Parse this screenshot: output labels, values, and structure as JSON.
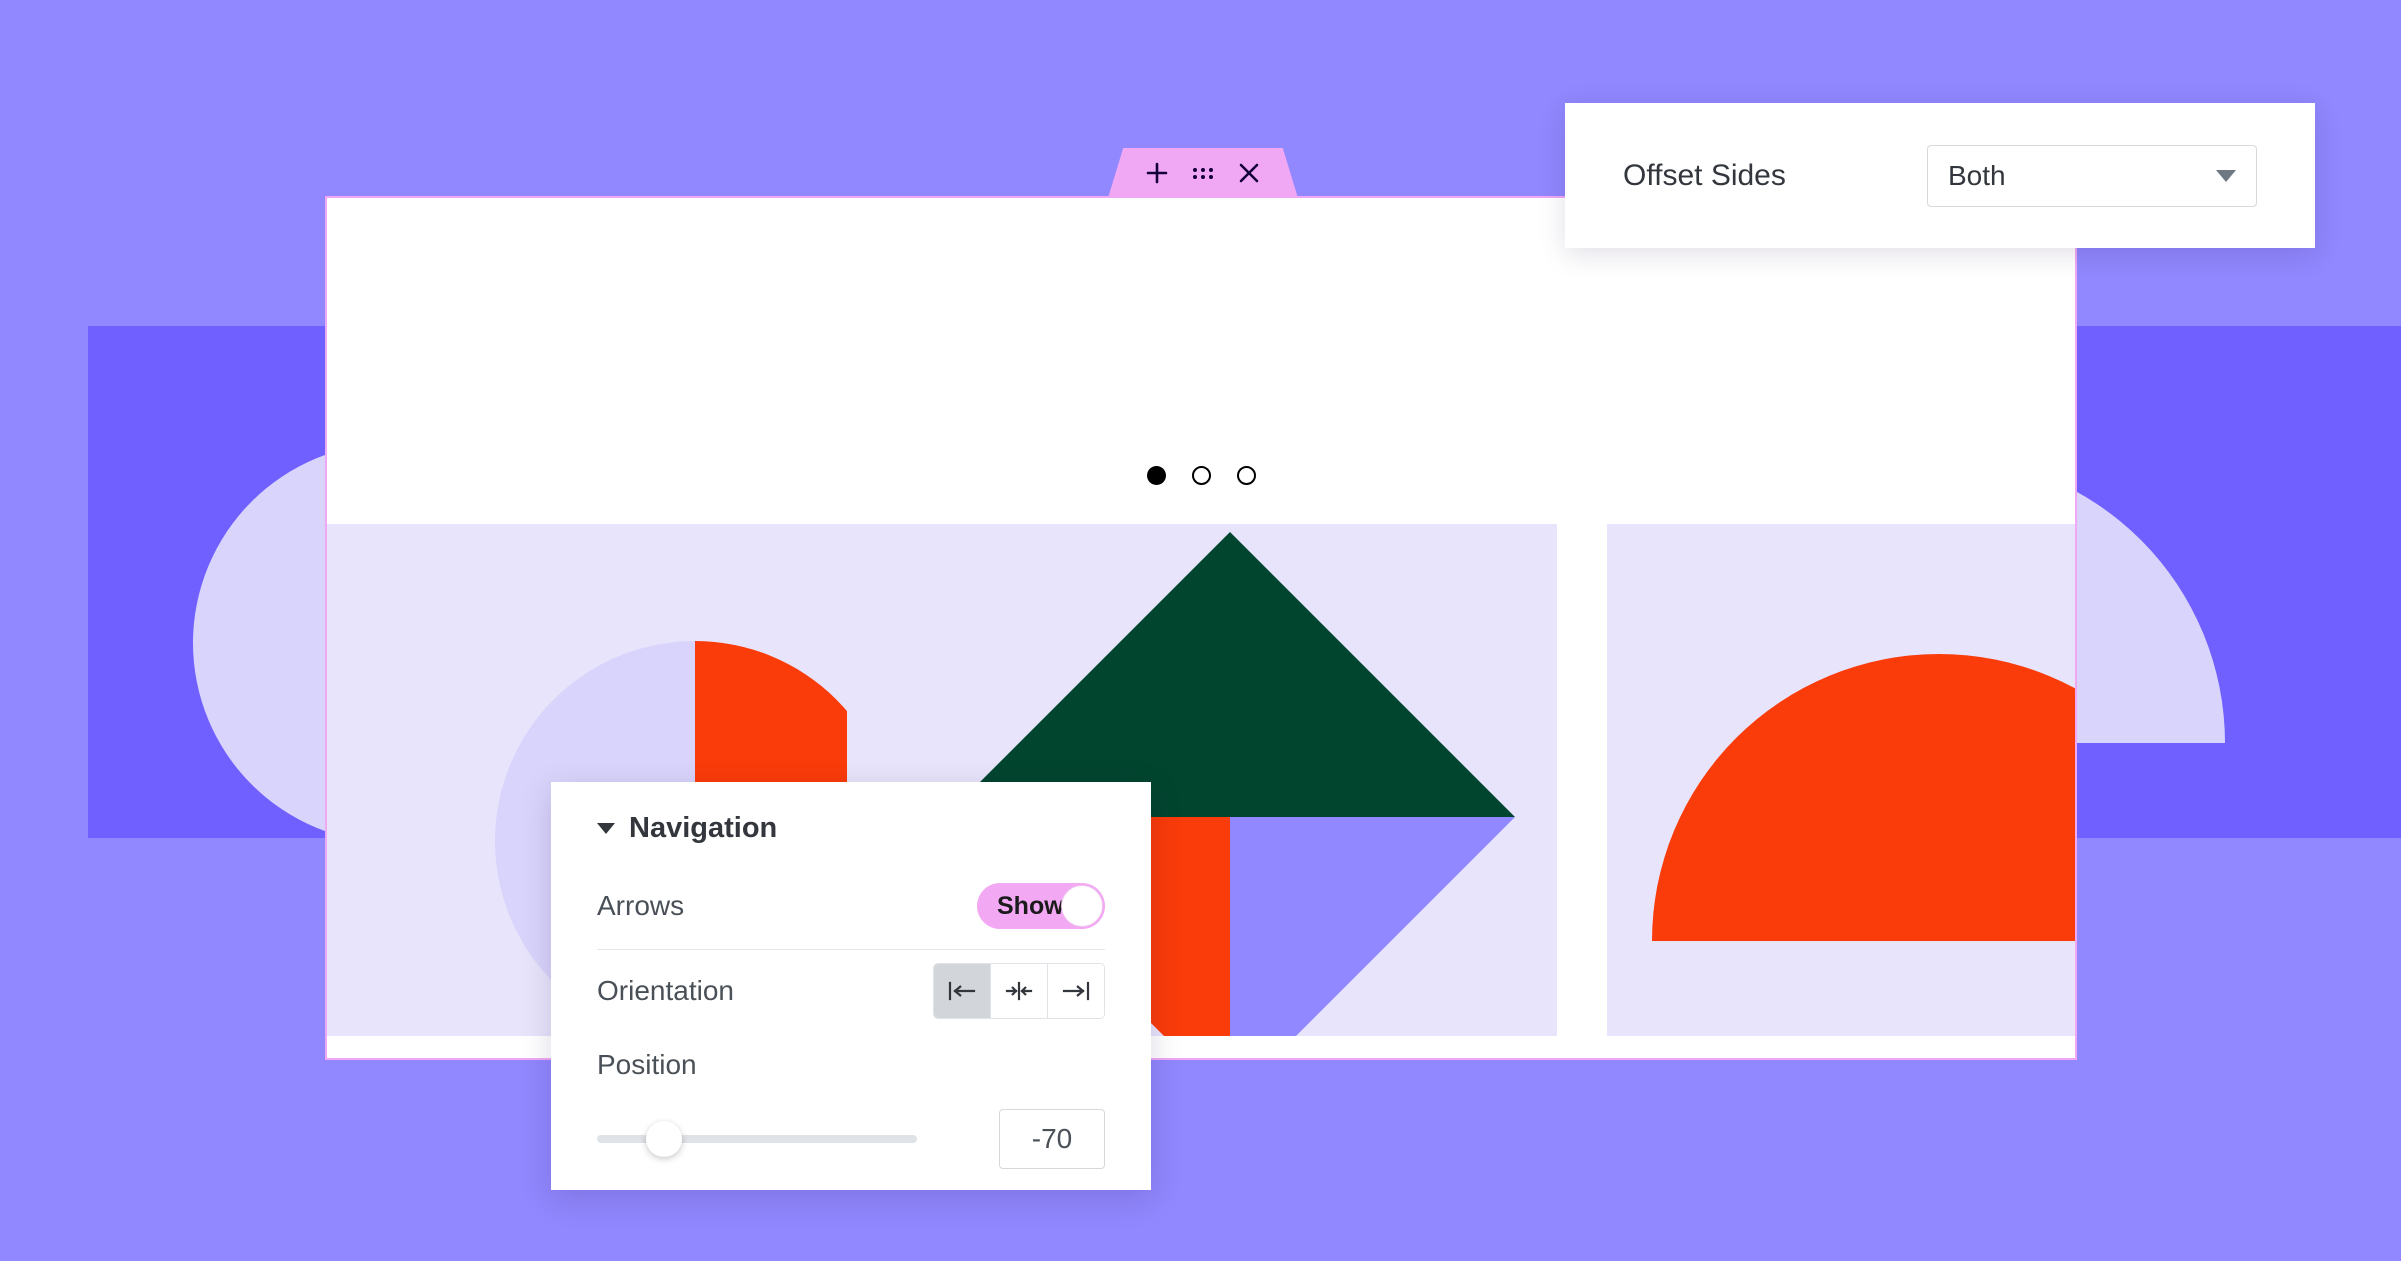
{
  "canvas": {
    "background_color": "#9187FE",
    "accent_purple": "#7060FF",
    "slide_background": "#E8E4FB",
    "shape_orange": "#FA3B0A",
    "shape_green": "#02452E",
    "shape_lavender": "#D9D4FB",
    "panel_border_pink": "#F0A8F5"
  },
  "element_toolbar": {
    "add_icon": "plus-icon",
    "drag_icon": "drag-handle-dots-icon",
    "close_icon": "close-icon"
  },
  "carousel": {
    "dots": [
      {
        "state": "active"
      },
      {
        "state": "inactive"
      },
      {
        "state": "inactive"
      }
    ],
    "prev_arrow_icon": "arrow-left-icon",
    "next_arrow_icon": "arrow-right-icon",
    "slides": [
      {
        "name": "slide-1",
        "shape": "split-circle"
      },
      {
        "name": "slide-2",
        "shape": "quartered-diamond"
      },
      {
        "name": "slide-3",
        "shape": "half-dome"
      }
    ]
  },
  "offset_card": {
    "label": "Offset Sides",
    "select_value": "Both",
    "select_options": [
      "Both"
    ],
    "caret_icon": "chevron-down-icon"
  },
  "navigation_card": {
    "title": "Navigation",
    "collapse_icon": "caret-down-icon",
    "arrows": {
      "label": "Arrows",
      "toggle_value": "Show",
      "toggle_state": "on"
    },
    "orientation": {
      "label": "Orientation",
      "options": [
        {
          "name": "align-left",
          "icon": "align-left-icon",
          "selected": true
        },
        {
          "name": "align-center",
          "icon": "align-center-icon",
          "selected": false
        },
        {
          "name": "align-right",
          "icon": "align-right-icon",
          "selected": false
        }
      ]
    },
    "position": {
      "label": "Position",
      "value": "-70",
      "slider_percent": 21
    }
  }
}
